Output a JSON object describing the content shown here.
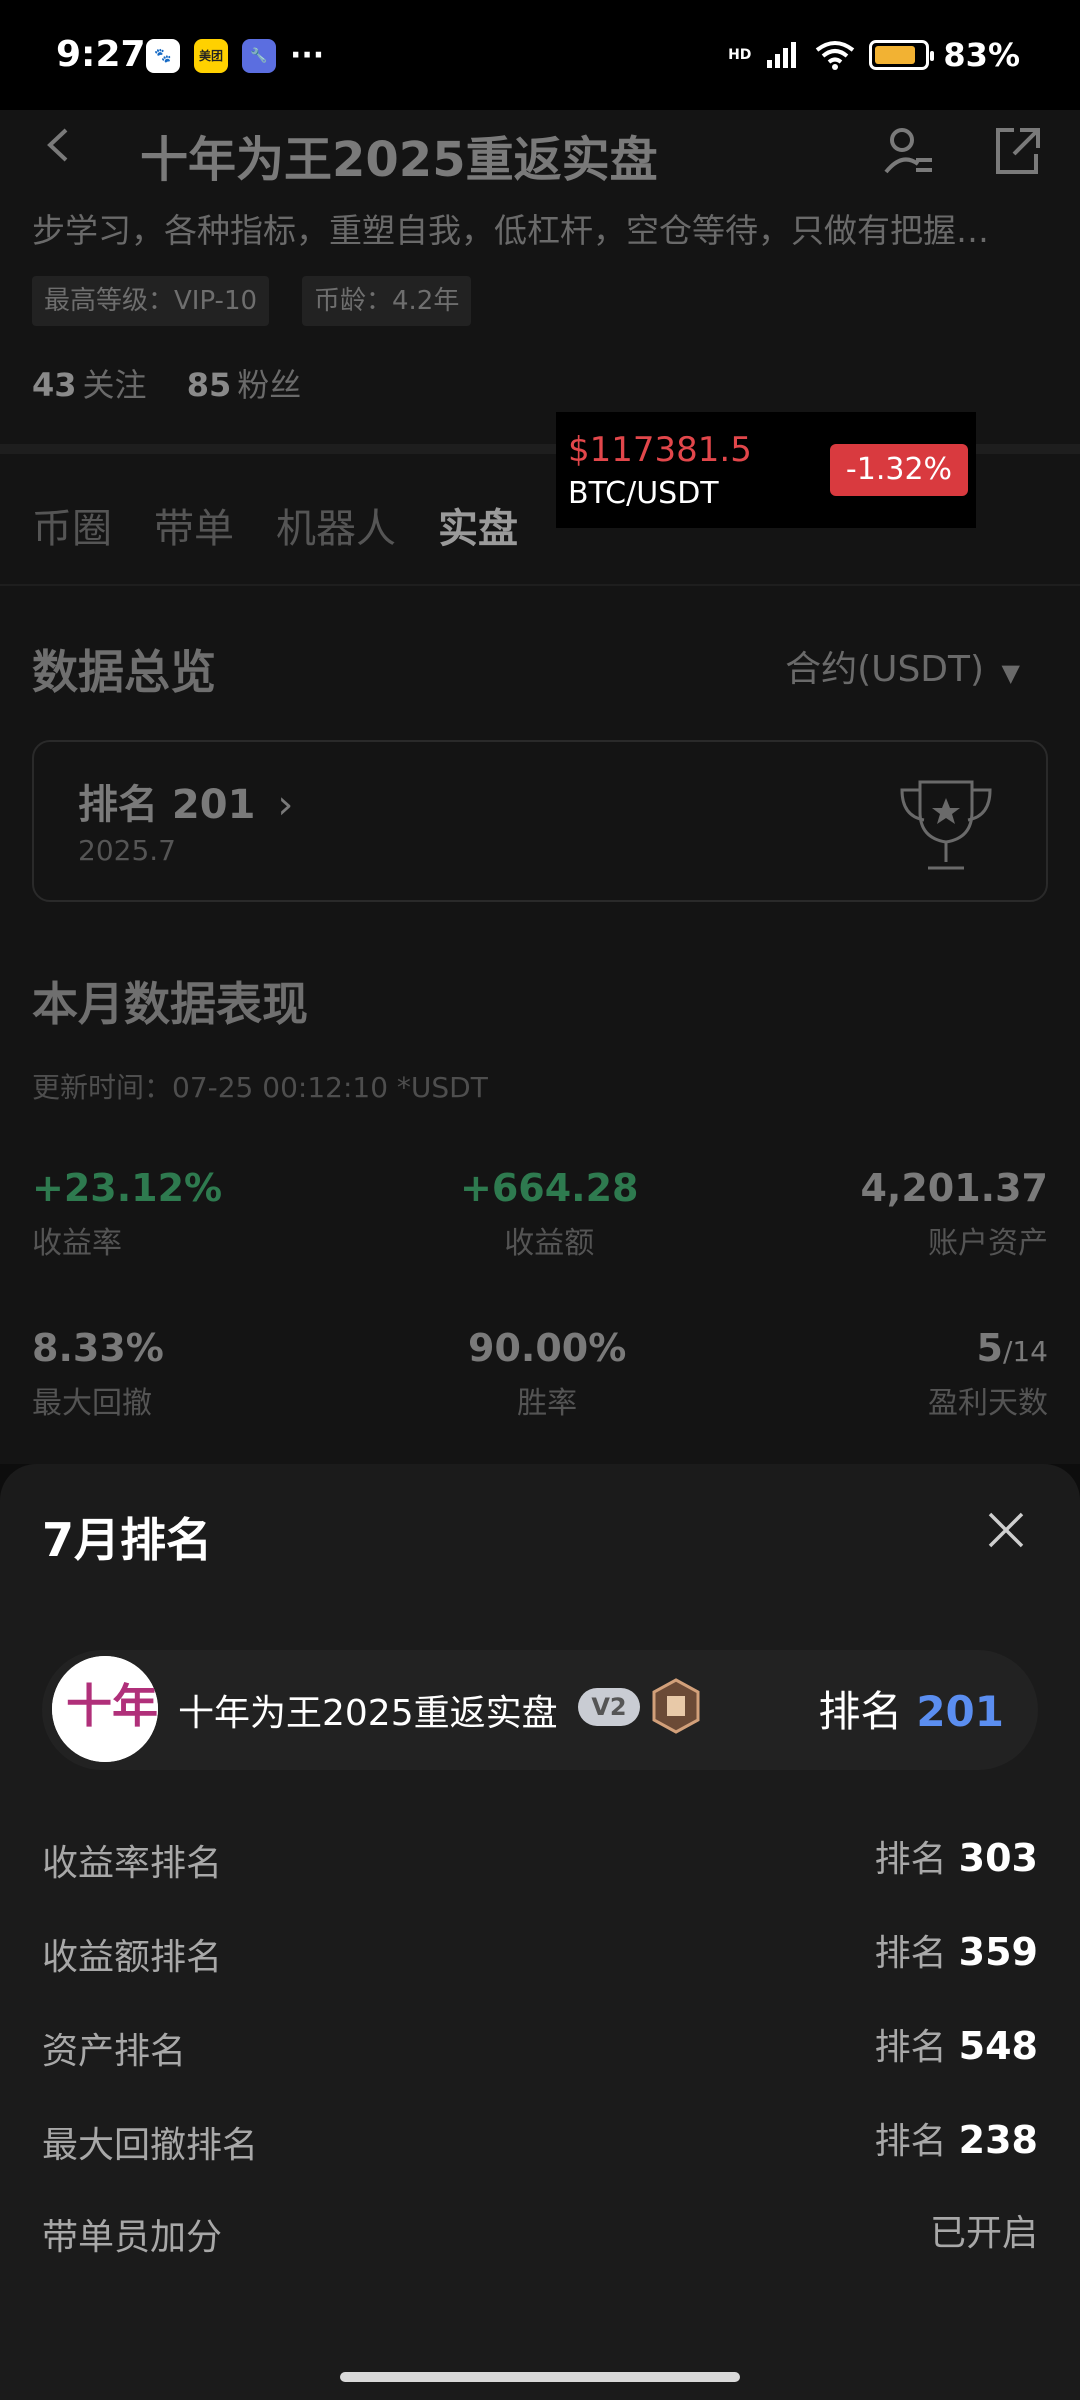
{
  "status_bar": {
    "time": "9:27",
    "app1": "美团",
    "network": "HD",
    "battery_pct": "83%",
    "battery_level": 0.83
  },
  "header": {
    "title": "十年为王2025重返实盘"
  },
  "profile": {
    "bio": "步学习，各种指标，重塑自我，低杠杆，空仓等待，只做有把握…",
    "tag_level": "最高等级：VIP-10",
    "tag_age": "币龄：4.2年",
    "following_count": "43",
    "following_label": "关注",
    "followers_count": "85",
    "followers_label": "粉丝"
  },
  "tabs": [
    {
      "label": "币圈"
    },
    {
      "label": "带单"
    },
    {
      "label": "机器人"
    },
    {
      "label": "实盘"
    }
  ],
  "ticker": {
    "price": "$117381.5",
    "pair": "BTC/USDT",
    "change": "-1.32%"
  },
  "overview": {
    "title": "数据总览",
    "contract": "合约(USDT)",
    "rank_label": "排名 201",
    "rank_date": "2025.7"
  },
  "monthly": {
    "title": "本月数据表现",
    "update": "更新时间：07-25 00:12:10  *USDT",
    "stats": [
      {
        "value": "+23.12%",
        "label": "收益率"
      },
      {
        "value": "+664.28",
        "label": "收益额"
      },
      {
        "value": "4,201.37",
        "label": "账户资产"
      },
      {
        "value": "8.33%",
        "label": "最大回撤"
      },
      {
        "value": "90.00%",
        "label": "胜率"
      },
      {
        "value": "5",
        "value_small": "/14",
        "label": "盈利天数"
      }
    ]
  },
  "sheet": {
    "title": "7月排名",
    "user": {
      "name": "十年为王2025重返实盘",
      "badge": "V2",
      "rank_label": "排名",
      "rank": "201",
      "avatar_text": "十年"
    },
    "rows": [
      {
        "label": "收益率排名",
        "prefix": "排名",
        "value": "303"
      },
      {
        "label": "收益额排名",
        "prefix": "排名",
        "value": "359"
      },
      {
        "label": "资产排名",
        "prefix": "排名",
        "value": "548"
      },
      {
        "label": "最大回撤排名",
        "prefix": "排名",
        "value": "238"
      },
      {
        "label": "带单员加分",
        "prefix": "已开启",
        "value": ""
      }
    ]
  }
}
